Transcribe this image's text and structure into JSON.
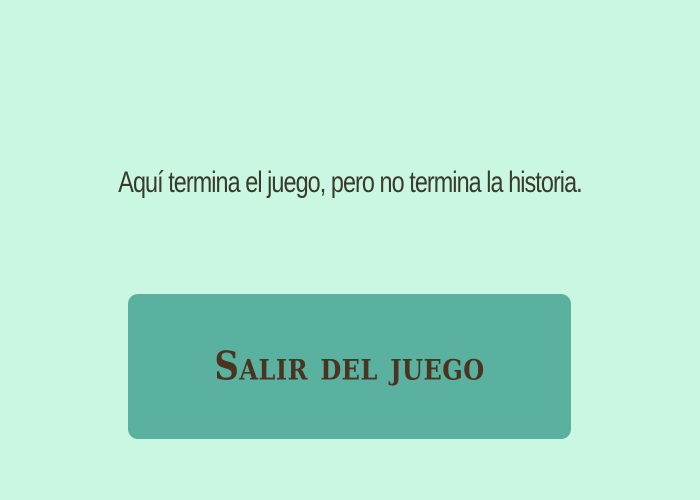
{
  "screen": {
    "message": "Aquí termina el juego, pero no termina la historia.",
    "exit_button": {
      "label": "Salir del juego"
    }
  },
  "colors": {
    "background": "#c9f7e2",
    "button": "#5bb19f",
    "message_text": "#3a3a2a",
    "button_text": "#4a3320"
  }
}
